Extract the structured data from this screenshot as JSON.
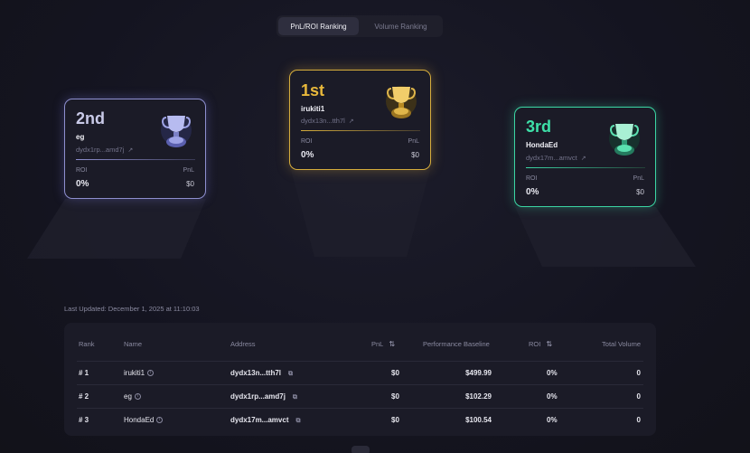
{
  "tabs": [
    {
      "label": "PnL/ROI Ranking",
      "active": true
    },
    {
      "label": "Volume Ranking",
      "active": false
    }
  ],
  "podium": {
    "first": {
      "rank": "1st",
      "name": "irukiti1",
      "address": "dydx13n...tth7l",
      "roi_label": "ROI",
      "roi": "0%",
      "pnl_label": "PnL",
      "pnl": "$0",
      "color": "#e8b83b"
    },
    "second": {
      "rank": "2nd",
      "name": "eg",
      "address": "dydx1rp...amd7j",
      "roi_label": "ROI",
      "roi": "0%",
      "pnl_label": "PnL",
      "pnl": "$0",
      "color": "#c9cae8"
    },
    "third": {
      "rank": "3rd",
      "name": "HondaEd",
      "address": "dydx17m...amvct",
      "roi_label": "ROI",
      "roi": "0%",
      "pnl_label": "PnL",
      "pnl": "$0",
      "color": "#3ee0a8"
    }
  },
  "last_updated": "Last Updated: December 1, 2025 at 11:10:03",
  "table": {
    "headers": {
      "rank": "Rank",
      "name": "Name",
      "address": "Address",
      "pnl": "PnL",
      "baseline": "Performance Baseline",
      "roi": "ROI",
      "volume": "Total Volume"
    },
    "rows": [
      {
        "rank": "# 1",
        "name": "irukiti1",
        "address": "dydx13n...tth7l",
        "pnl": "$0",
        "baseline": "$499.99",
        "roi": "0%",
        "volume": "0"
      },
      {
        "rank": "# 2",
        "name": "eg",
        "address": "dydx1rp...amd7j",
        "pnl": "$0",
        "baseline": "$102.29",
        "roi": "0%",
        "volume": "0"
      },
      {
        "rank": "# 3",
        "name": "HondaEd",
        "address": "dydx17m...amvct",
        "pnl": "$0",
        "baseline": "$100.54",
        "roi": "0%",
        "volume": "0"
      }
    ]
  },
  "icons": {
    "external_link": "external-link-icon",
    "info": "info-icon",
    "sort": "sort-icon",
    "trophy": "trophy-icon"
  }
}
